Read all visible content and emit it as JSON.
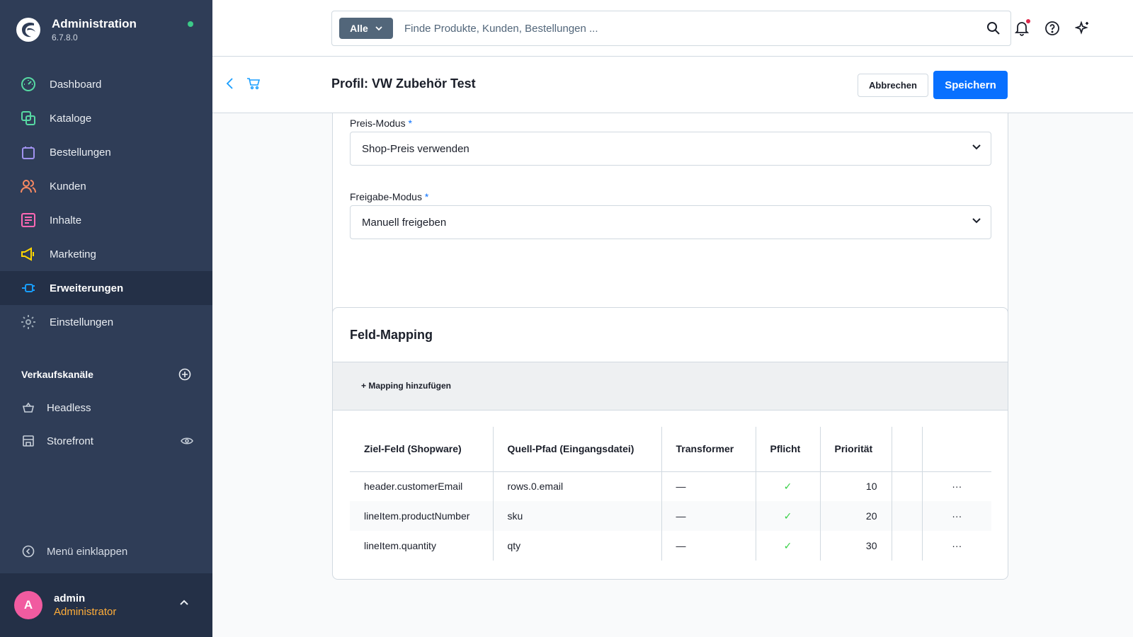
{
  "app": {
    "title": "Administration",
    "version": "6.7.8.0"
  },
  "nav": [
    {
      "label": "Dashboard",
      "icon": "dashboard-icon",
      "color": "#57d9a3"
    },
    {
      "label": "Kataloge",
      "icon": "catalogue-icon",
      "color": "#57d9a3"
    },
    {
      "label": "Bestellungen",
      "icon": "bag-icon",
      "color": "#a092f0"
    },
    {
      "label": "Kunden",
      "icon": "users-icon",
      "color": "#f88962"
    },
    {
      "label": "Inhalte",
      "icon": "content-icon",
      "color": "#ff68b4"
    },
    {
      "label": "Marketing",
      "icon": "megaphone-icon",
      "color": "#ffd700"
    },
    {
      "label": "Erweiterungen",
      "icon": "plugin-icon",
      "color": "#189eff",
      "active": true
    },
    {
      "label": "Einstellungen",
      "icon": "gear-icon",
      "color": "#9aa8b5"
    }
  ],
  "sales_channels": {
    "header": "Verkaufskanäle",
    "items": [
      {
        "label": "Headless",
        "icon": "basket-icon"
      },
      {
        "label": "Storefront",
        "icon": "storefront-icon"
      }
    ]
  },
  "collapse_label": "Menü einklappen",
  "user": {
    "initial": "A",
    "name": "admin",
    "role": "Administrator"
  },
  "search": {
    "type": "Alle",
    "placeholder": "Finde Produkte, Kunden, Bestellungen ..."
  },
  "smartbar": {
    "title": "Profil: VW Zubehör Test",
    "cancel": "Abbrechen",
    "save": "Speichern"
  },
  "settings": {
    "price_mode": {
      "label": "Preis-Modus",
      "required": "*",
      "value": "Shop-Preis verwenden"
    },
    "release_mode": {
      "label": "Freigabe-Modus",
      "required": "*",
      "value": "Manuell freigeben"
    }
  },
  "mapping": {
    "title": "Feld-Mapping",
    "add_label": "+ Mapping hinzufügen",
    "columns": [
      "Ziel-Feld (Shopware)",
      "Quell-Pfad (Eingangsdatei)",
      "Transformer",
      "Pflicht",
      "Priorität",
      "",
      ""
    ],
    "rows": [
      {
        "target": "header.customerEmail",
        "source": "rows.0.email",
        "transformer": "—",
        "required": "✓",
        "priority": "10",
        "actions": "···"
      },
      {
        "target": "lineItem.productNumber",
        "source": "sku",
        "transformer": "—",
        "required": "✓",
        "priority": "20",
        "actions": "···"
      },
      {
        "target": "lineItem.quantity",
        "source": "qty",
        "transformer": "—",
        "required": "✓",
        "priority": "30",
        "actions": "···"
      }
    ]
  },
  "colors": {
    "sidebar": "#2f3d57",
    "sidebar_active": "#243047",
    "primary": "#0870ff",
    "role": "#ffad39",
    "avatar": "#f15ba0",
    "check": "#37d046",
    "status": "#3cca88"
  }
}
